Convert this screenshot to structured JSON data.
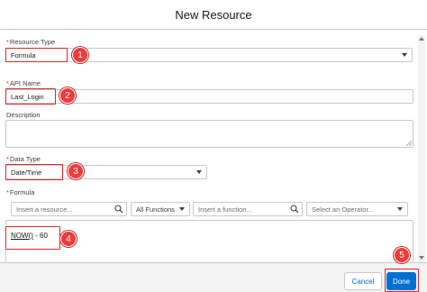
{
  "modal": {
    "title": "New Resource"
  },
  "fields": {
    "resource_type": {
      "label": "Resource Type",
      "value": "Formula"
    },
    "api_name": {
      "label": "API Name",
      "value": "Last_Login"
    },
    "description": {
      "label": "Description",
      "value": ""
    },
    "data_type": {
      "label": "Data Type",
      "value": "Date/Time"
    },
    "formula": {
      "label": "Formula",
      "resource_search_placeholder": "Insert a resource...",
      "functions_filter": "All Functions",
      "function_search_placeholder": "Insert a function...",
      "operator_placeholder": "Select an Operator...",
      "expression_function": "NOW()",
      "expression_rest": " - 60"
    }
  },
  "required_marker": "*",
  "annotations": [
    "1",
    "2",
    "3",
    "4",
    "5"
  ],
  "footer": {
    "cancel_label": "Cancel",
    "done_label": "Done"
  },
  "colors": {
    "accent": "#0070d2",
    "annotation_red": "#e0242c",
    "required": "#c23934"
  },
  "icons": [
    "chevron-down-icon",
    "search-icon",
    "resize-grip-icon"
  ]
}
